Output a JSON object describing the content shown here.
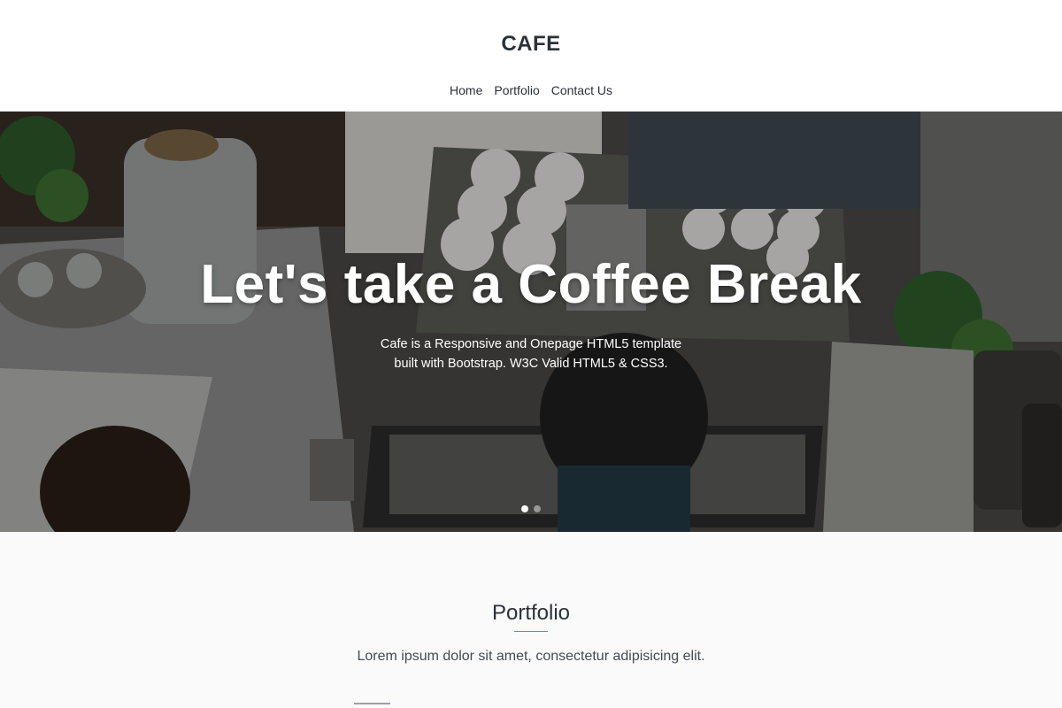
{
  "header": {
    "logo": "CAFE",
    "nav": [
      {
        "label": "Home"
      },
      {
        "label": "Portfolio"
      },
      {
        "label": "Contact Us"
      }
    ]
  },
  "hero": {
    "title": "Let's take a Coffee Break",
    "subtitle_line1": "Cafe is a Responsive and Onepage HTML5 template",
    "subtitle_line2": "built with Bootstrap. W3C Valid HTML5 & CSS3.",
    "slide_count": 2,
    "active_slide": 1
  },
  "portfolio": {
    "title": "Portfolio",
    "text": "Lorem ipsum dolor sit amet, consectetur adipisicing elit."
  },
  "colors": {
    "accent": "#b07a4b",
    "text_dark": "#2c3138",
    "section_bg": "#fafafa"
  }
}
